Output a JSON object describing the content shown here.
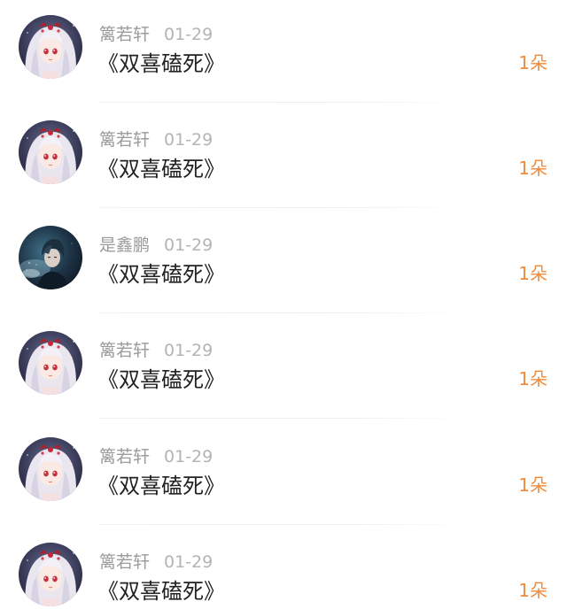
{
  "comments": [
    {
      "avatar": "anime-girl-avatar",
      "name": "篱若轩",
      "date": "01-29",
      "text": "《双喜磕死》",
      "gift": "1朵"
    },
    {
      "avatar": "anime-girl-avatar",
      "name": "篱若轩",
      "date": "01-29",
      "text": "《双喜磕死》",
      "gift": "1朵"
    },
    {
      "avatar": "dark-hair-boy-avatar",
      "name": "是鑫鹏",
      "date": "01-29",
      "text": "《双喜磕死》",
      "gift": "1朵"
    },
    {
      "avatar": "anime-girl-avatar",
      "name": "篱若轩",
      "date": "01-29",
      "text": "《双喜磕死》",
      "gift": "1朵"
    },
    {
      "avatar": "anime-girl-avatar",
      "name": "篱若轩",
      "date": "01-29",
      "text": "《双喜磕死》",
      "gift": "1朵"
    },
    {
      "avatar": "anime-girl-avatar",
      "name": "篱若轩",
      "date": "01-29",
      "text": "《双喜磕死》",
      "gift": "1朵"
    }
  ],
  "colors": {
    "name": "#9b9b9b",
    "date": "#b4b4b4",
    "text": "#222222",
    "gift": "#f08a3c"
  }
}
